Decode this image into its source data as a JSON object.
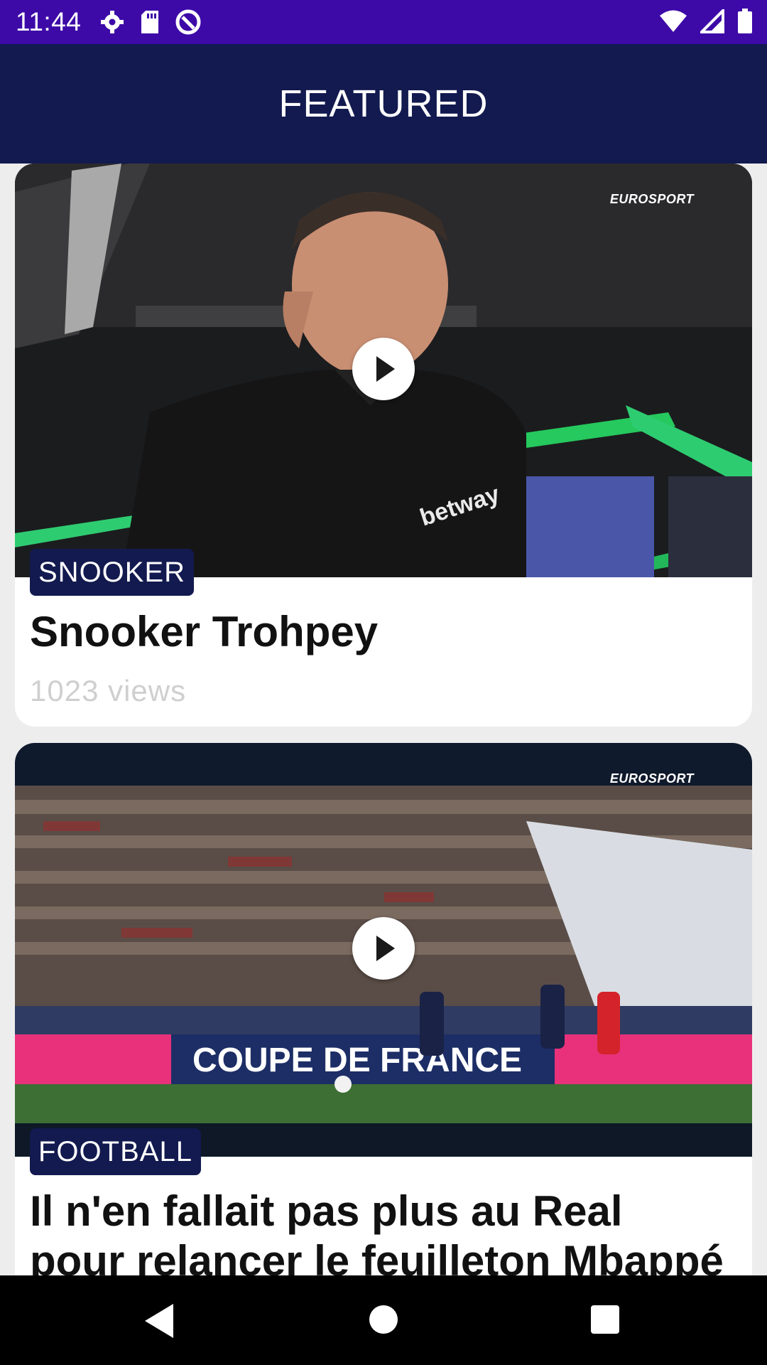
{
  "status_bar": {
    "time": "11:44",
    "left_icons": [
      "settings-icon",
      "sd-card-icon",
      "data-saver-icon"
    ],
    "right_icons": [
      "wifi-icon",
      "signal-icon",
      "battery-icon"
    ]
  },
  "app_bar": {
    "title": "FEATURED"
  },
  "colors": {
    "status_bar": "#3d0aa8",
    "app_bar": "#121a4f",
    "tag": "#121a4f"
  },
  "cards": [
    {
      "category": "SNOOKER",
      "title": "Snooker Trohpey",
      "views": "1023 views",
      "media_logo": "EUROSPORT",
      "scene_text": "betway"
    },
    {
      "category": "FOOTBALL",
      "title": "Il n'en fallait pas plus au Real pour relancer le feuilleton Mbappé",
      "media_logo": "EUROSPORT",
      "scene_text": "COUPE DE FRANCE"
    }
  ],
  "nav_bar": {
    "buttons": [
      "back-button",
      "home-button",
      "recents-button"
    ]
  }
}
